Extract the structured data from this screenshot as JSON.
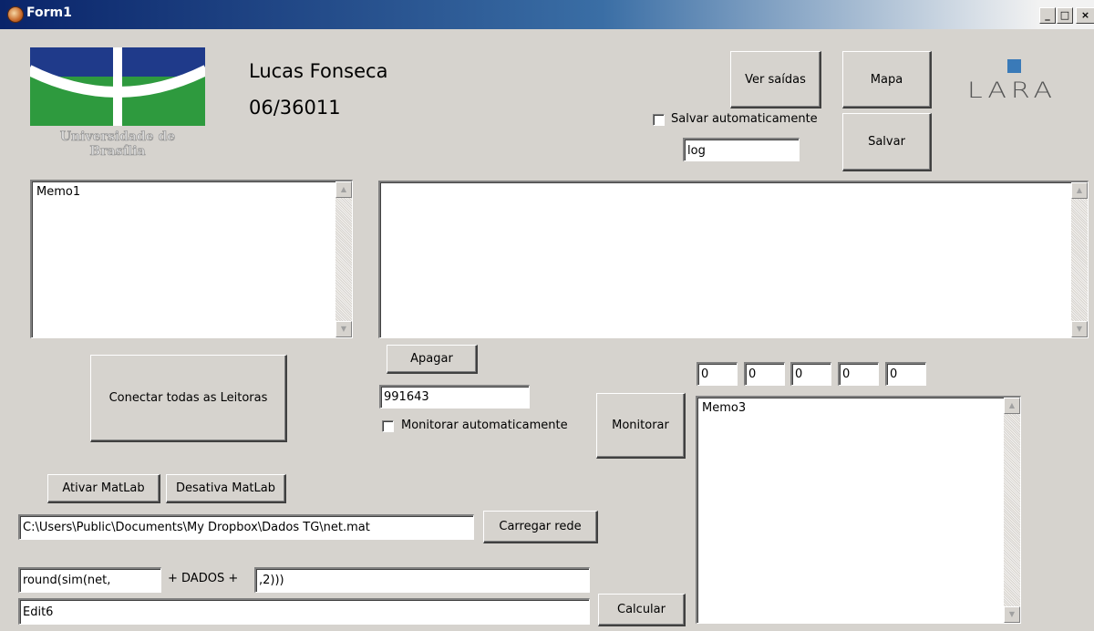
{
  "window": {
    "title": "Form1",
    "minimize": "_",
    "maximize": "□",
    "close": "×"
  },
  "header": {
    "university_label": "Universidade de Brasília",
    "student_name": "Lucas Fonseca",
    "student_id": "06/36011",
    "lab_logo": "LARA"
  },
  "top_controls": {
    "ver_saidas": "Ver saídas",
    "mapa": "Mapa",
    "salvar": "Salvar",
    "salvar_auto_label": "Salvar automaticamente",
    "log_value": "log"
  },
  "memos": {
    "memo1": "Memo1",
    "memo2": "",
    "memo3": "Memo3"
  },
  "readers": {
    "conectar": "Conectar todas as Leitoras",
    "apagar": "Apagar",
    "id_value": "991643",
    "monitorar_auto_label": "Monitorar automaticamente",
    "monitorar": "Monitorar"
  },
  "counters": [
    "0",
    "0",
    "0",
    "0",
    "0"
  ],
  "matlab": {
    "ativar": "Ativar MatLab",
    "desativa": "Desativa MatLab",
    "path": "C:\\Users\\Public\\Documents\\My Dropbox\\Dados TG\\net.mat",
    "carregar": "Carregar rede",
    "expr_prefix": "round(sim(net,",
    "plus_dados": "+ DADOS +",
    "expr_suffix": ",2)))",
    "edit6": "Edit6",
    "calcular": "Calcular"
  },
  "colors": {
    "face": "#d6d3ce",
    "unb_blue": "#1f3a8a",
    "unb_green": "#2e9a3e",
    "lara_blue": "#3a7ab8"
  }
}
